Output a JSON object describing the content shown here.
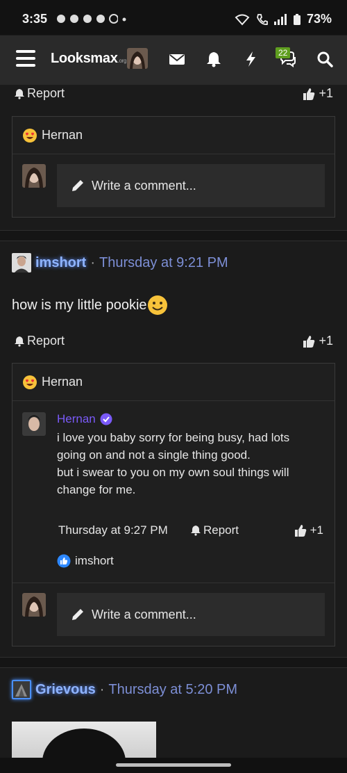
{
  "status": {
    "time": "3:35",
    "battery": "73%"
  },
  "nav": {
    "logo": "Looksmax",
    "logo_suffix": ".org",
    "notifications_count": "22"
  },
  "posts_top": {
    "report": "Report",
    "like_count": "+1",
    "reaction_user": "Hernan",
    "write_placeholder": "Write a comment..."
  },
  "post1": {
    "username": "imshort",
    "time": "Thursday at 9:21 PM",
    "body": "how is my little pookie",
    "report": "Report",
    "like_count": "+1",
    "reaction_user": "Hernan",
    "reply": {
      "name": "Hernan",
      "text_lines": [
        "i love you baby sorry for being busy, had lots going on and not a single thing good.",
        "but i swear to you on my own soul things will change for me."
      ],
      "time": "Thursday at 9:27 PM",
      "report": "Report",
      "like_count": "+1",
      "liked_by": "imshort"
    },
    "write_placeholder": "Write a comment..."
  },
  "post2": {
    "username": "Grievous",
    "time": "Thursday at 5:20 PM"
  },
  "colors": {
    "background": "#1b1b1b",
    "nav": "#2a2a2a",
    "link_time": "#7d8fd6",
    "username_glow": "#8fb4ff",
    "reply_name": "#7a5af8",
    "badge": "#5f9e1f"
  }
}
